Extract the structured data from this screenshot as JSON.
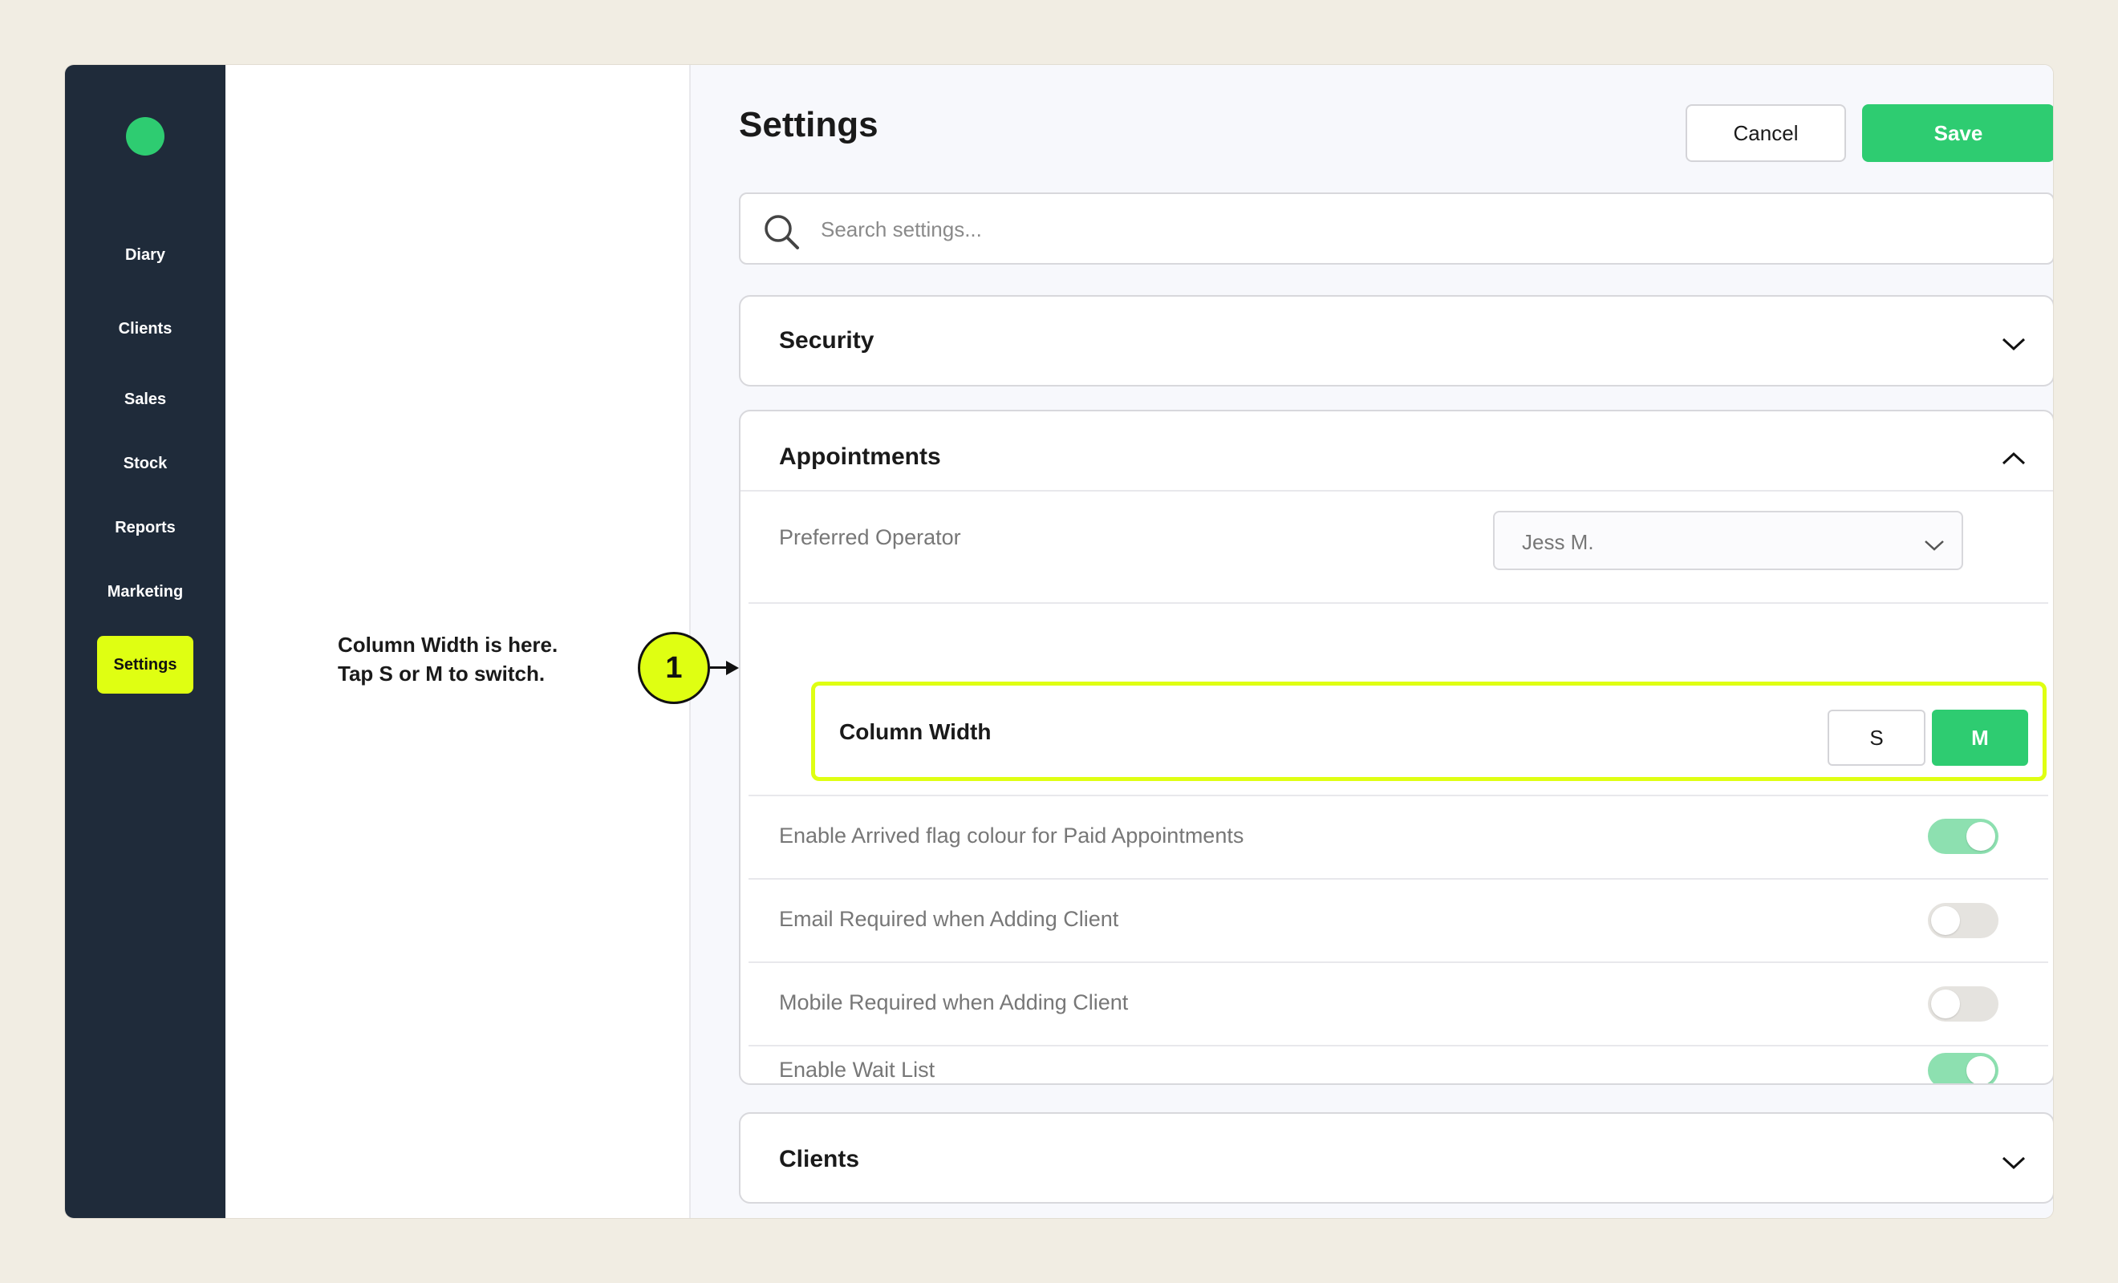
{
  "sidebar": {
    "items": [
      {
        "label": "Diary"
      },
      {
        "label": "Clients"
      },
      {
        "label": "Sales"
      },
      {
        "label": "Stock"
      },
      {
        "label": "Reports"
      },
      {
        "label": "Marketing"
      },
      {
        "label": "Settings",
        "active": true
      }
    ]
  },
  "helper": {
    "text": "Column Width is here.\nTap S or M to switch.",
    "step": "1"
  },
  "header": {
    "title": "Settings",
    "cancel_label": "Cancel",
    "save_label": "Save"
  },
  "search": {
    "placeholder": "Search settings..."
  },
  "sections": {
    "security": {
      "title": "Security",
      "expanded": false
    },
    "appointments": {
      "title": "Appointments",
      "expanded": true,
      "preferred_operator": {
        "label": "Preferred Operator",
        "value": "Jess M."
      },
      "column_width": {
        "label": "Column Width",
        "options": [
          "S",
          "M"
        ],
        "selected": "M"
      },
      "toggles": [
        {
          "label": "Enable Arrived flag colour for Paid Appointments",
          "on": true
        },
        {
          "label": "Email Required when Adding Client",
          "on": false
        },
        {
          "label": "Mobile Required when Adding Client",
          "on": false
        },
        {
          "label": "Enable Wait List",
          "on": true
        }
      ]
    },
    "clients": {
      "title": "Clients",
      "expanded": false
    }
  },
  "colors": {
    "sidebar_bg": "#1f2b3a",
    "accent_green": "#2ecc71",
    "highlight_yellow": "#dfff12",
    "toggle_on": "#8de0b0",
    "toggle_off": "#e5e3df"
  },
  "icons": {
    "logo": "green-dot-logo",
    "search": "search-icon",
    "expand": "chevron-down-icon",
    "collapse": "chevron-up-icon"
  }
}
